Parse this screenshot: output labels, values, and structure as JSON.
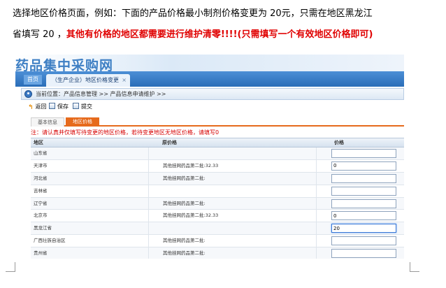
{
  "instructions": {
    "line1": "选择地区价格页面，例如：下面的产品价格最小制剂价格变更为 20元，只需在地区黑龙江",
    "line2_prefix": "省填写 20 ，",
    "line2_emphasis": "其他有价格的地区都需要进行维护清零!!!!(只需填写一个有效地区价格即可)"
  },
  "app": {
    "logo": "药品集中采购网",
    "tabs": {
      "home": "首页",
      "active": "（生产企业）地区价格变更",
      "close": "×"
    },
    "breadcrumb": "当前位置：产品信息管理 >> 产品信息申请维护 >>",
    "toolbar": {
      "back": "返回",
      "save": "保存",
      "submit": "提交"
    },
    "subtabs": {
      "basic": "基本信息",
      "region": "地区价格"
    },
    "note": "注：请认真并仅填写待变更的地区价格，若待变更地区无地区价格，请填写0",
    "table": {
      "headers": {
        "region": "地区",
        "original": "原价格",
        "price": "价格"
      },
      "rows": [
        {
          "region": "山东省",
          "original": "",
          "price": ""
        },
        {
          "region": "天津市",
          "original": "其他挂网药品第二批:32.33",
          "price": "0"
        },
        {
          "region": "河北省",
          "original": "其他挂网药品第二批:",
          "price": ""
        },
        {
          "region": "吉林省",
          "original": "",
          "price": ""
        },
        {
          "region": "辽宁省",
          "original": "其他挂网药品第二批:",
          "price": ""
        },
        {
          "region": "北京市",
          "original": "其他挂网药品第二批:32.33",
          "price": "0"
        },
        {
          "region": "黑龙江省",
          "original": "",
          "price": "20"
        },
        {
          "region": "广西壮族自治区",
          "original": "其他挂网药品第二批:",
          "price": ""
        },
        {
          "region": "贵州省",
          "original": "其他挂网药品第二批:",
          "price": ""
        }
      ]
    }
  },
  "colors": {
    "accent_tab": "#e66a1c",
    "note_red": "#d60000",
    "header_blue": "#2a6db8"
  }
}
